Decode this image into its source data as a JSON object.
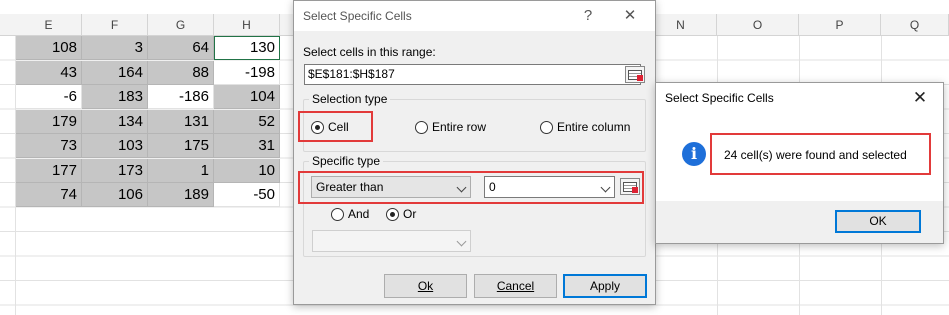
{
  "spreadsheet": {
    "columns": [
      "E",
      "F",
      "G",
      "H",
      "N",
      "O",
      "P",
      "Q"
    ],
    "rows": [
      [
        "108",
        "3",
        "64",
        "130"
      ],
      [
        "43",
        "164",
        "88",
        "-198"
      ],
      [
        "-6",
        "183",
        "-186",
        "104"
      ],
      [
        "179",
        "134",
        "131",
        "52"
      ],
      [
        "73",
        "103",
        "175",
        "31"
      ],
      [
        "177",
        "173",
        "1",
        "10"
      ],
      [
        "74",
        "106",
        "189",
        "-50"
      ]
    ]
  },
  "select_dialog": {
    "title": "Select Specific Cells",
    "help_glyph": "?",
    "close_glyph": "✕",
    "range_label": "Select cells in this range:",
    "range_value": "$E$181:$H$187",
    "selection_type": {
      "legend": "Selection type",
      "options": [
        "Cell",
        "Entire row",
        "Entire column"
      ],
      "selected": "Cell"
    },
    "specific_type": {
      "legend": "Specific type",
      "condition": "Greater than",
      "value": "0",
      "logic_options": [
        "And",
        "Or"
      ],
      "logic_selected": "Or",
      "second_condition": ""
    },
    "buttons": {
      "ok": "Ok",
      "cancel": "Cancel",
      "apply": "Apply"
    }
  },
  "message_box": {
    "title": "Select Specific Cells",
    "close_glyph": "✕",
    "icon": "info-icon",
    "icon_glyph": "i",
    "message": "24 cell(s) were found and selected",
    "ok_label": "OK"
  },
  "colors": {
    "highlight": "#e23a3a",
    "selected_cell": "#c6c6c6",
    "info_blue": "#1e6fd9",
    "primary_button_border": "#0078d7"
  }
}
